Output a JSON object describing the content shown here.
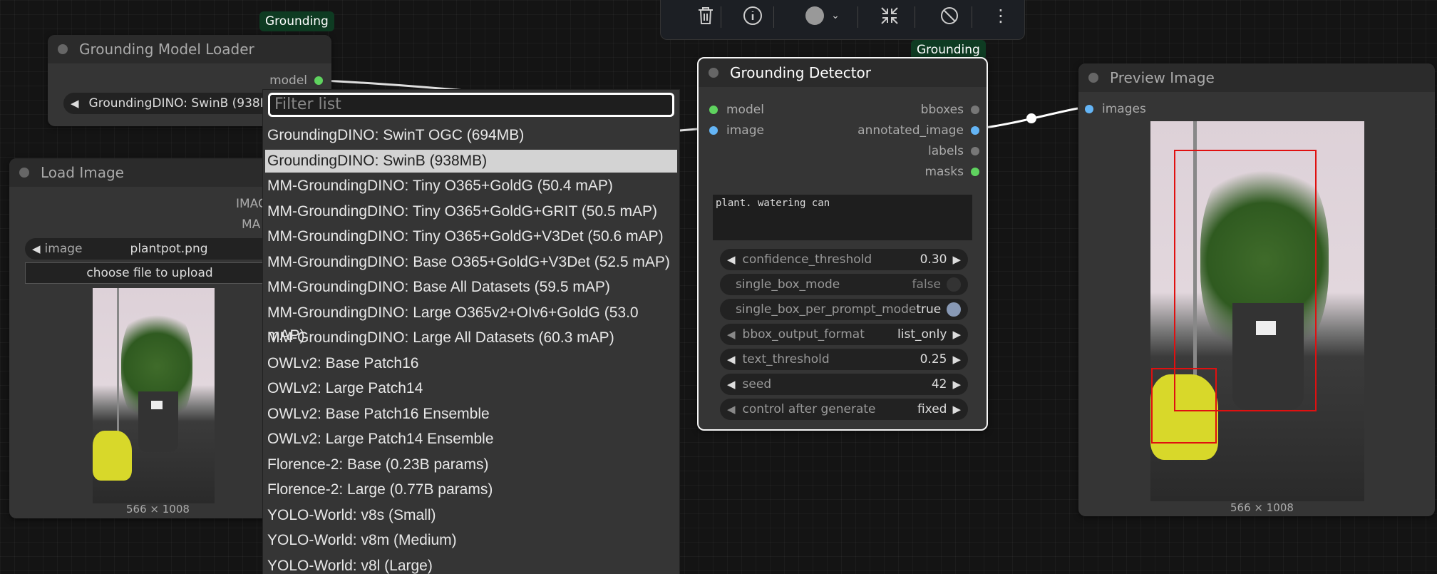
{
  "toolbar": {
    "items": [
      "trash-icon",
      "info-icon",
      "color-icon",
      "collapse-icon",
      "bypass-icon",
      "more-icon"
    ]
  },
  "loader_node": {
    "badge": "Grounding",
    "title": "Grounding Model Loader",
    "output_model": "model",
    "model_value": "GroundingDINO: SwinB (938M"
  },
  "load_image_node": {
    "title": "Load Image",
    "out_image": "IMAG",
    "out_mask": "MA",
    "image_label": "image",
    "image_value": "plantpot.png",
    "upload_label": "choose file to upload",
    "dims": "566 × 1008"
  },
  "dropdown": {
    "filter_placeholder": "Filter list",
    "items": [
      "GroundingDINO: SwinT OGC (694MB)",
      "GroundingDINO: SwinB (938MB)",
      "MM-GroundingDINO: Tiny O365+GoldG (50.4 mAP)",
      "MM-GroundingDINO: Tiny O365+GoldG+GRIT (50.5 mAP)",
      "MM-GroundingDINO: Tiny O365+GoldG+V3Det (50.6 mAP)",
      "MM-GroundingDINO: Base O365+GoldG+V3Det (52.5 mAP)",
      "MM-GroundingDINO: Base All Datasets (59.5 mAP)",
      "MM-GroundingDINO: Large O365v2+OIv6+GoldG (53.0 mAP)",
      "MM-GroundingDINO: Large All Datasets (60.3 mAP)",
      "OWLv2: Base Patch16",
      "OWLv2: Large Patch14",
      "OWLv2: Base Patch16 Ensemble",
      "OWLv2: Large Patch14 Ensemble",
      "Florence-2: Base (0.23B params)",
      "Florence-2: Large (0.77B params)",
      "YOLO-World: v8s (Small)",
      "YOLO-World: v8m (Medium)",
      "YOLO-World: v8l (Large)"
    ],
    "selected_index": 1
  },
  "detector_node": {
    "badge": "Grounding",
    "title": "Grounding Detector",
    "in_model": "model",
    "in_image": "image",
    "out_bboxes": "bboxes",
    "out_annotated": "annotated_image",
    "out_labels": "labels",
    "out_masks": "masks",
    "prompt": "plant. watering can",
    "widgets": [
      {
        "label": "confidence_threshold",
        "value": "0.30"
      },
      {
        "label": "single_box_mode",
        "value": "false"
      },
      {
        "label": "single_box_per_prompt_mode",
        "value": "true"
      },
      {
        "label": "bbox_output_format",
        "value": "list_only"
      },
      {
        "label": "text_threshold",
        "value": "0.25"
      },
      {
        "label": "seed",
        "value": "42"
      },
      {
        "label": "control after generate",
        "value": "fixed"
      }
    ]
  },
  "preview_node": {
    "title": "Preview Image",
    "in_images": "images",
    "dims": "566 × 1008"
  },
  "colors": {
    "model_slot": "#5fd35f",
    "image_slot": "#64b5f6",
    "badge_bg": "#0e3b22",
    "bbox": "#e01010"
  }
}
